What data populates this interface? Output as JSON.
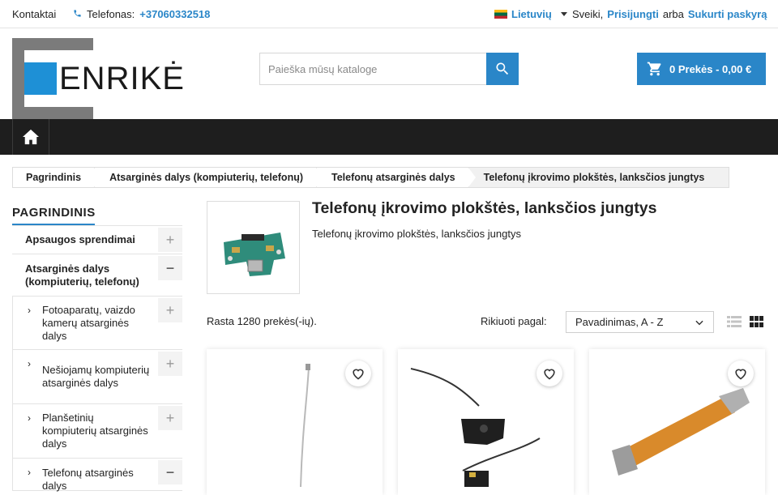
{
  "topbar": {
    "contact": "Kontaktai",
    "phone_label": "Telefonas:",
    "phone_number": "+37060332518",
    "language": "Lietuvių",
    "greeting": "Sveiki,",
    "login": "Prisijungti",
    "or": "arba",
    "register": "Sukurti paskyrą"
  },
  "logo": {
    "text": "ENRIKĖ"
  },
  "search": {
    "placeholder": "Paieška mūsų kataloge"
  },
  "cart": {
    "label": "0 Prekės - 0,00 €"
  },
  "breadcrumb": [
    "Pagrindinis",
    "Atsarginės dalys (kompiuterių, telefonų)",
    "Telefonų atsarginės dalys",
    "Telefonų įkrovimo plokštės, lanksčios jungtys"
  ],
  "sidebar": {
    "title": "PAGRINDINIS",
    "categories": [
      {
        "label": "Apsaugos sprendimai",
        "toggle": "+"
      },
      {
        "label": "Atsarginės dalys (kompiuterių, telefonų)",
        "toggle": "−"
      }
    ],
    "subcategories": [
      {
        "label": "Fotoaparatų, vaizdo kamerų atsarginės dalys",
        "toggle": "+"
      },
      {
        "label": "Nešiojamų kompiuterių atsarginės dalys",
        "toggle": "+"
      },
      {
        "label": "Planšetinių kompiuterių atsarginės dalys",
        "toggle": "+"
      },
      {
        "label": "Telefonų atsarginės dalys",
        "toggle": "−"
      }
    ]
  },
  "category": {
    "title": "Telefonų įkrovimo plokštės, lanksčios jungtys",
    "description": "Telefonų įkrovimo plokštės, lanksčios jungtys"
  },
  "listing": {
    "count": "Rasta 1280 prekės(-ių).",
    "sort_label": "Rikiuoti pagal:",
    "sort_value": "Pavadinimas, A - Z"
  },
  "colors": {
    "accent": "#2a86c8",
    "nav": "#1e1e1e"
  }
}
